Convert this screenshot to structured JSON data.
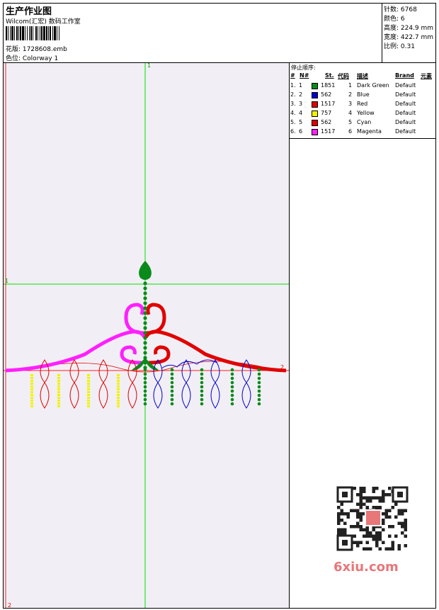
{
  "header": {
    "title": "生产作业图",
    "subtitle": "Wilcom(汇宏) 数码工作室",
    "design_line": "花版: 1728608.emb",
    "colorway_line": "色位: Colorway 1"
  },
  "info": {
    "stitches": "针数: 6768",
    "colors": "颜色: 6",
    "height": "高度: 224.9 mm",
    "width": "宽度: 422.7 mm",
    "scale": "比例: 0.31"
  },
  "table": {
    "title": "停止顺序:",
    "headers": [
      "#",
      "N#",
      "St.",
      "代码",
      "描述",
      "Brand",
      "元素"
    ],
    "rows": [
      {
        "idx": "1.",
        "n": "1",
        "color": "#0a8a1a",
        "st": "1851",
        "code": "1",
        "desc": "Dark Green",
        "brand": "Default"
      },
      {
        "idx": "2.",
        "n": "2",
        "color": "#0000cc",
        "st": "562",
        "code": "2",
        "desc": "Blue",
        "brand": "Default"
      },
      {
        "idx": "3.",
        "n": "3",
        "color": "#e00000",
        "st": "1517",
        "code": "3",
        "desc": "Red",
        "brand": "Default"
      },
      {
        "idx": "4.",
        "n": "4",
        "color": "#f2f200",
        "st": "757",
        "code": "4",
        "desc": "Yellow",
        "brand": "Default"
      },
      {
        "idx": "5.",
        "n": "5",
        "color": "#e00000",
        "st": "562",
        "code": "5",
        "desc": "Cyan",
        "brand": "Default"
      },
      {
        "idx": "6.",
        "n": "6",
        "color": "#ff20ff",
        "st": "1517",
        "code": "6",
        "desc": "Magenta",
        "brand": "Default"
      }
    ]
  },
  "axes": {
    "v1": "1",
    "h1": "1",
    "h2": "2",
    "v2": "2"
  },
  "watermark": {
    "brand": "6xiu.com"
  },
  "colors": {
    "green": "#0a8a1a",
    "blue": "#0000cc",
    "red": "#e00000",
    "yellow": "#f2f200",
    "magenta": "#ff20ff",
    "guide_green": "#00e000",
    "guide_red": "#ff2020"
  }
}
